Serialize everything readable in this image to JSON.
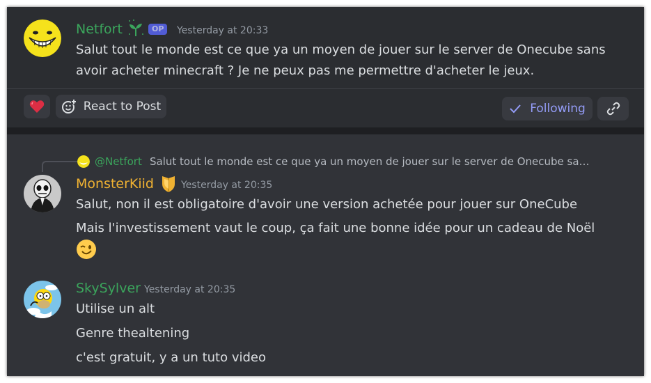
{
  "post": {
    "author": "Netfort",
    "op_badge": "OP",
    "timestamp": "Yesterday at 20:33",
    "text_line1": "Salut tout le monde est ce que ya un moyen de jouer sur le server de Onecube sans",
    "text_line2": "avoir acheter minecraft ? Je ne peux pas me permettre d'acheter le jeux.",
    "react_label": "React to Post",
    "following_label": "Following",
    "reaction_emoji": "❤️"
  },
  "reply": {
    "mention": "@Netfort",
    "preview": "Salut tout le monde est ce que ya un moyen de jouer sur le server de Onecube sa…"
  },
  "messages": [
    {
      "author": "MonsterKiid",
      "timestamp": "Yesterday at 20:35",
      "lines": [
        "Salut, non il est obligatoire d'avoir une version achetée pour jouer sur OneCube",
        "Mais l'investissement vaut le coup, ça fait une bonne idée pour un cadeau de Noël"
      ],
      "emoji": "😉"
    },
    {
      "author": "SkySylver",
      "timestamp": "Yesterday at 20:35",
      "lines": [
        "Utilise un alt",
        "Genre thealtening",
        "c'est gratuit, y a un tuto video"
      ]
    }
  ],
  "colors": {
    "background": "#313338",
    "post_background": "#2b2d31",
    "green_name": "#3ba55c",
    "gold_name": "#f0b232",
    "following_blue": "#949cf7",
    "op_badge": "#5865f2"
  },
  "icons": [
    "sprout-icon",
    "crest-icon",
    "react-emoji-icon",
    "checkmark-icon",
    "link-icon"
  ]
}
